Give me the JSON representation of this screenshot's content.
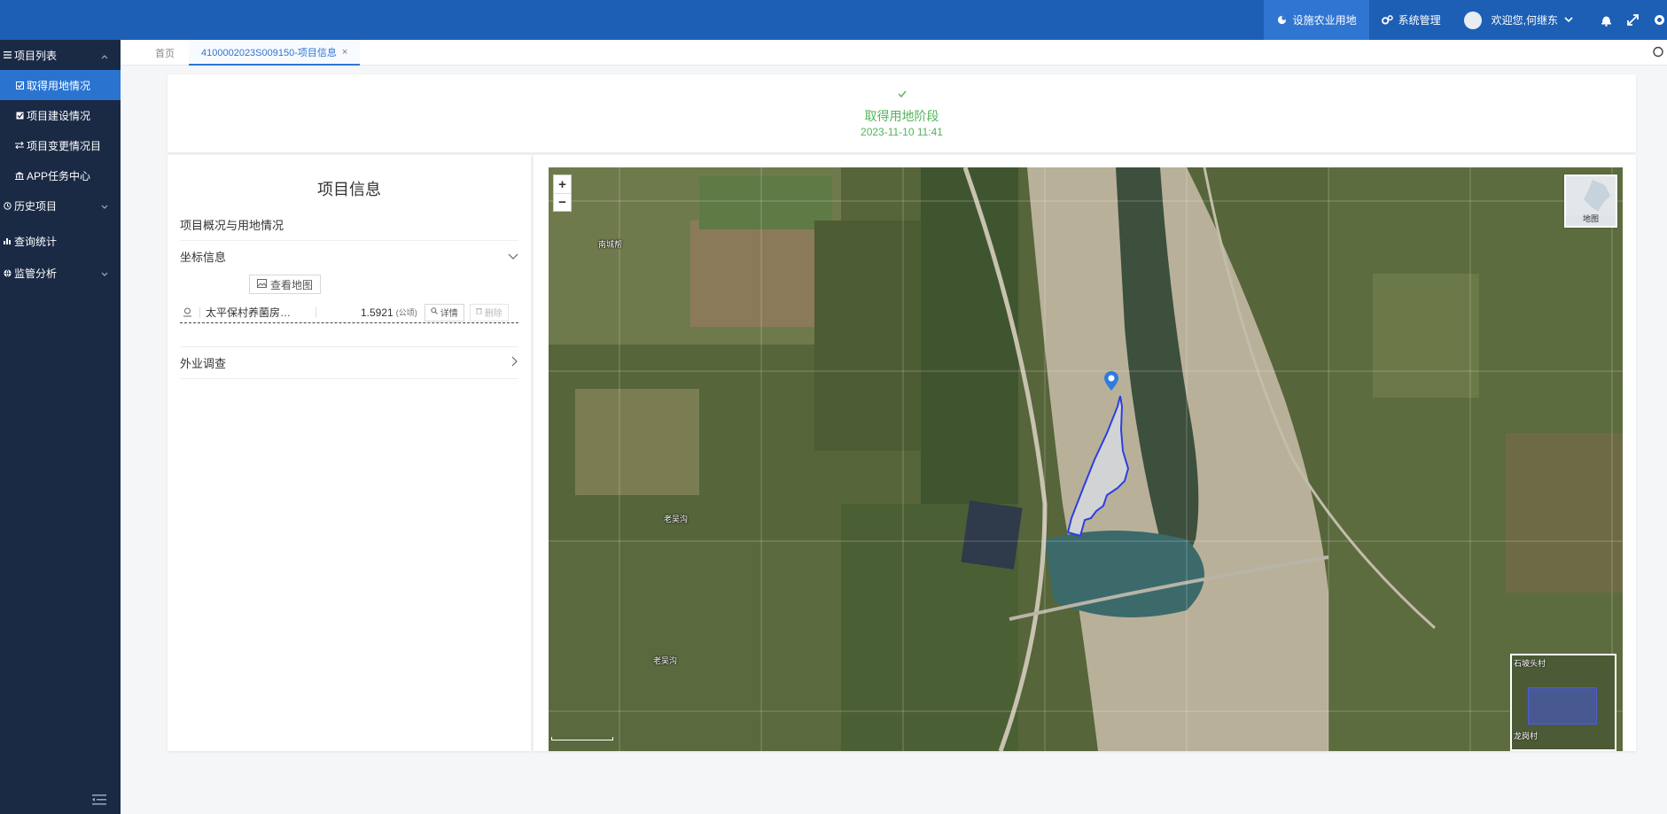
{
  "topbar": {
    "items": [
      {
        "label": "设施农业用地",
        "icon": "pie-chart-icon"
      },
      {
        "label": "系统管理",
        "icon": "gears-icon"
      },
      {
        "label": "欢迎您,何继东",
        "icon": "avatar"
      }
    ],
    "accent": "#1d5fb4"
  },
  "sidebar": {
    "items": [
      {
        "label": "项目列表",
        "icon": "list-icon",
        "expanded": true
      },
      {
        "label": "取得用地情况",
        "icon": "checkbox-icon",
        "active": true
      },
      {
        "label": "项目建设情况",
        "icon": "checkbox-icon"
      },
      {
        "label": "项目变更情况目",
        "icon": "exchange-icon"
      },
      {
        "label": "APP任务中心",
        "icon": "bank-icon"
      },
      {
        "label": "历史项目",
        "icon": "history-icon"
      },
      {
        "label": "查询统计",
        "icon": "bar-chart-icon"
      },
      {
        "label": "监管分析",
        "icon": "globe-icon"
      }
    ]
  },
  "tabs": [
    {
      "label": "首页"
    },
    {
      "label": "4100002023S009150-项目信息",
      "active": true,
      "close": "×"
    }
  ],
  "stage": {
    "title": "取得用地阶段",
    "date": "2023-11-10 11:41",
    "color": "#52b45a"
  },
  "info": {
    "title": "项目信息",
    "overview": "项目概况与用地情况",
    "coords": "坐标信息",
    "view_map": "查看地图",
    "parcel": {
      "name": "太平保村养菌房…",
      "area": "1.5921",
      "unit": "(公顷)",
      "detail": "详情",
      "delete": "删除"
    },
    "field_survey": "外业调查"
  },
  "map": {
    "zoom_in": "+",
    "zoom_out": "−",
    "layer_label": "地图",
    "labels": [
      "南城帮",
      "老吴沟",
      "老吴沟"
    ],
    "overview_labels": [
      "石坡头村",
      "龙岗村"
    ],
    "parcel_color": "#2b3fe0"
  }
}
